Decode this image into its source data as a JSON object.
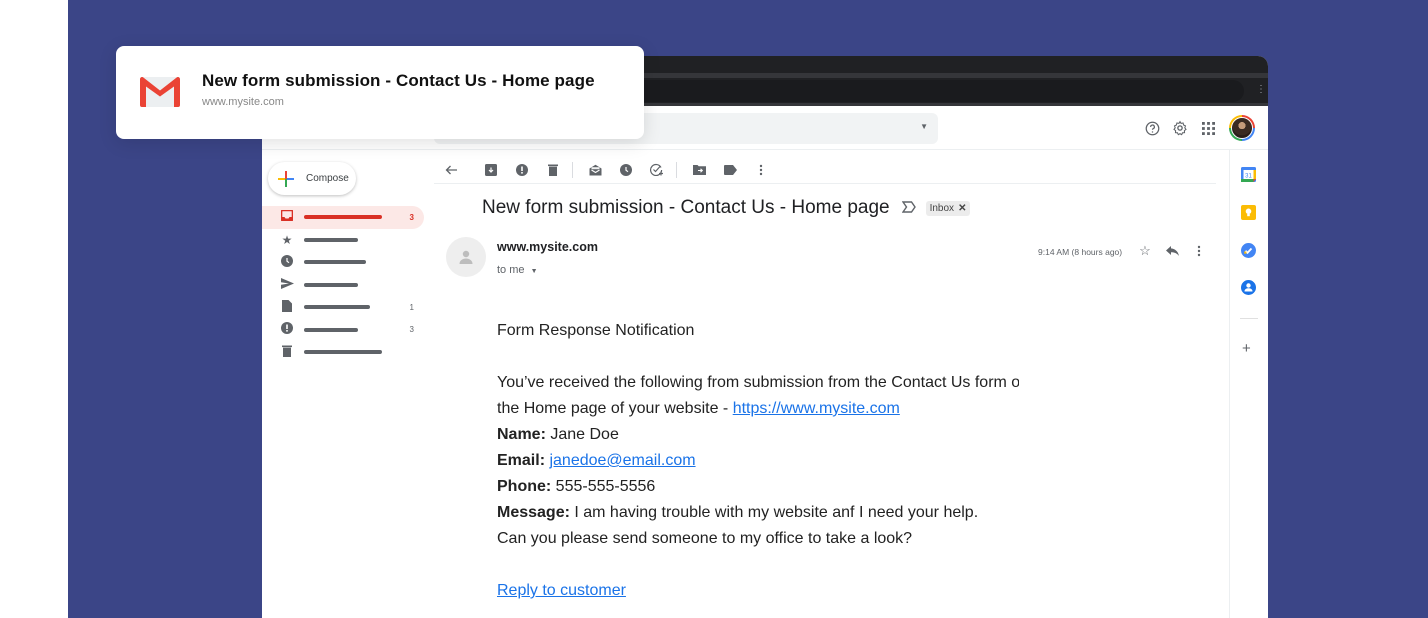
{
  "notification": {
    "app_icon": "gmail-icon",
    "title": "New form submission - Contact Us - Home page",
    "subtitle": "www.mysite.com"
  },
  "header": {
    "icons": [
      "help-icon",
      "settings-gear-icon",
      "apps-grid-icon",
      "account-avatar"
    ]
  },
  "sidebar": {
    "compose_label": "Compose",
    "items": [
      {
        "icon": "inbox-icon",
        "count": "3",
        "active": true
      },
      {
        "icon": "star-icon",
        "count": ""
      },
      {
        "icon": "snoozed-clock-icon",
        "count": ""
      },
      {
        "icon": "sent-icon",
        "count": ""
      },
      {
        "icon": "drafts-icon",
        "count": "1"
      },
      {
        "icon": "spam-icon",
        "count": "3"
      },
      {
        "icon": "trash-icon",
        "count": ""
      }
    ]
  },
  "toolbar": {
    "icons": [
      "back-arrow-icon",
      "archive-icon",
      "report-spam-icon",
      "delete-icon",
      "mark-unread-icon",
      "snooze-icon",
      "add-task-icon",
      "move-to-icon",
      "label-icon",
      "more-icon"
    ]
  },
  "email": {
    "subject": "New form submission - Contact Us - Home page",
    "label_chip": "Inbox",
    "sender": "www.mysite.com",
    "recipient": "to me",
    "timestamp": "9:14 AM (8 hours ago)",
    "body": {
      "heading": "Form Response Notification",
      "intro_line1": "You’ve received the following from submission from the Contact Us form on",
      "intro_line2_prefix": "the Home page of your website - ",
      "site_link": "https://www.mysite.com",
      "name_label": "Name:",
      "name_value": " Jane Doe",
      "email_label": "Email:",
      "email_value": "janedoe@email.com",
      "phone_label": "Phone:",
      "phone_value": " 555-555-5556",
      "message_label": "Message:",
      "message_value": " I am having trouble with my website anf I need your help.",
      "message_line2": "Can you please send someone to my office to take a look?",
      "reply_link": "Reply to customer"
    }
  },
  "side_panel": {
    "icons": [
      "calendar-icon",
      "keep-icon",
      "tasks-icon",
      "contacts-icon",
      "add-addon-icon"
    ],
    "calendar_day": "31"
  },
  "colors": {
    "background": "#3b4587",
    "gmail_red": "#d93025",
    "link_blue": "#1a73e8"
  }
}
